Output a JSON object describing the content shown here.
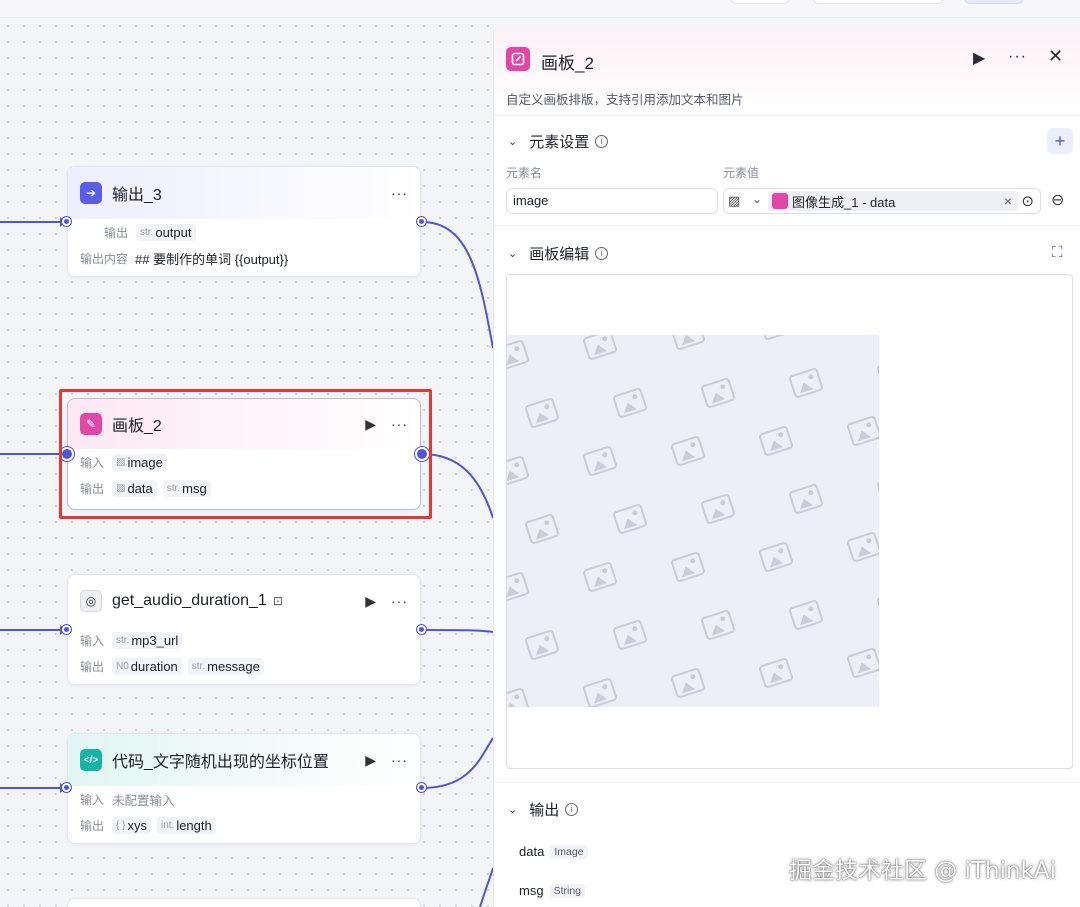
{
  "canvas": {
    "nodes": {
      "output3": {
        "title": "输出_3",
        "row1_label": "输出",
        "row1_tag_type": "str.",
        "row1_tag_value": "output",
        "row2_label": "输出内容",
        "row2_value": "## 要制作的单词 {{output}}"
      },
      "board2": {
        "title": "画板_2",
        "input_label": "输入",
        "input_value": "image",
        "output_label": "输出",
        "output_value1": "data",
        "output_value2_type": "str.",
        "output_value2": "msg"
      },
      "audio": {
        "title": "get_audio_duration_1",
        "input_label": "输入",
        "input_type": "str.",
        "input_value": "mp3_url",
        "output_label": "输出",
        "output1_type": "N0",
        "output1_value": "duration",
        "output2_type": "str.",
        "output2_value": "message"
      },
      "code": {
        "title": "代码_文字随机出现的坐标位置",
        "input_label": "输入",
        "input_value": "未配置输入",
        "output_label": "输出",
        "output1_type": "{ }",
        "output1_value": "xys",
        "output2_type": "int.",
        "output2_value": "length"
      }
    }
  },
  "panel": {
    "title": "画板_2",
    "description": "自定义画板排版，支持引用添加文本和图片",
    "element_settings": {
      "heading": "元素设置",
      "name_label": "元素名",
      "value_label": "元素值",
      "name_value": "image",
      "ref_chip": "图像生成_1 - data",
      "clear_icon": "×"
    },
    "board_edit": {
      "heading": "画板编辑"
    },
    "output": {
      "heading": "输出",
      "items": [
        {
          "name": "data",
          "type": "Image"
        },
        {
          "name": "msg",
          "type": "String"
        }
      ]
    }
  },
  "watermark": "掘金技术社区 @ iThinkAi",
  "colors": {
    "accent": "#4f55d9",
    "pink": "#e446a8",
    "selection": "#e53935",
    "teal": "#16b4a6"
  }
}
